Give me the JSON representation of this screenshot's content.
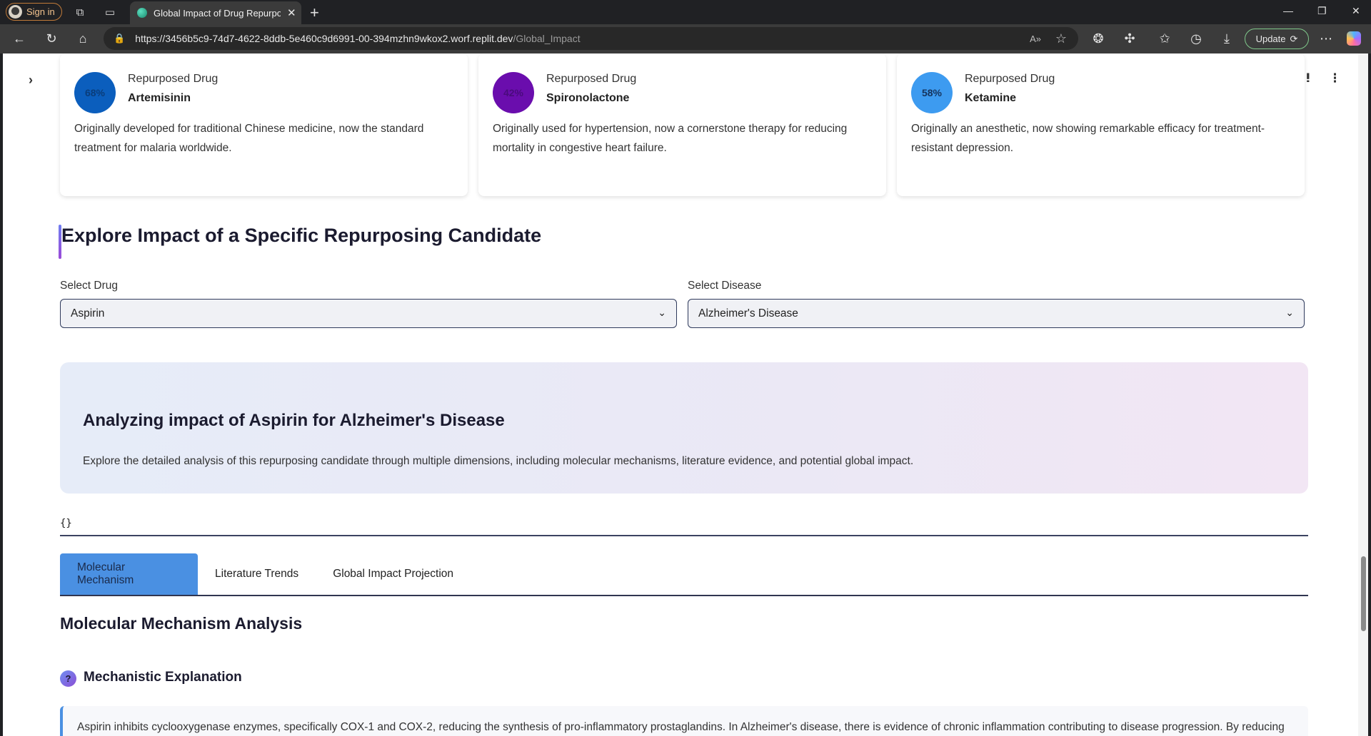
{
  "browser": {
    "signin_label": "Sign in",
    "tab_title": "Global Impact of Drug Repurposi",
    "url_main": "https://3456b5c9-74d7-4622-8ddb-5e460c9d6991-00-394mzhn9wkox2.worf.replit.dev",
    "url_path": "/Global_Impact",
    "update_label": "Update"
  },
  "cards": [
    {
      "percent": "68%",
      "percent_value": 68,
      "kind": "Repurposed Drug",
      "name": "Artemisinin",
      "color": "#0b5ebd",
      "text_color": "#0a3d7a",
      "description": "Originally developed for traditional Chinese medicine, now the standard treatment for malaria worldwide."
    },
    {
      "percent": "42%",
      "percent_value": 42,
      "kind": "Repurposed Drug",
      "name": "Spironolactone",
      "color": "#6a0dad",
      "text_color": "#4a0b7d",
      "description": "Originally used for hypertension, now a cornerstone therapy for reducing mortality in congestive heart failure."
    },
    {
      "percent": "58%",
      "percent_value": 58,
      "kind": "Repurposed Drug",
      "name": "Ketamine",
      "color": "#3d9bf0",
      "text_color": "#15335c",
      "description": "Originally an anesthetic, now showing remarkable efficacy for treatment-resistant depression."
    }
  ],
  "section": {
    "title": "Explore Impact of a Specific Repurposing Candidate"
  },
  "drug_select": {
    "label": "Select Drug",
    "value": "Aspirin"
  },
  "disease_select": {
    "label": "Select Disease",
    "value": "Alzheimer's Disease"
  },
  "analysis": {
    "title": "Analyzing impact of Aspirin for Alzheimer's Disease",
    "description": "Explore the detailed analysis of this repurposing candidate through multiple dimensions, including molecular mechanisms, literature evidence, and potential global impact."
  },
  "json_output": "{}",
  "tabs": [
    "Molecular Mechanism",
    "Literature Trends",
    "Global Impact Projection"
  ],
  "mechanism": {
    "title": "Molecular Mechanism Analysis",
    "subtitle": "Mechanistic Explanation",
    "icon_glyph": "?",
    "explanation": "Aspirin inhibits cyclooxygenase enzymes, specifically COX-1 and COX-2, reducing the synthesis of pro-inflammatory prostaglandins. In Alzheimer's disease, there is evidence of chronic inflammation contributing to disease progression. By reducing"
  }
}
